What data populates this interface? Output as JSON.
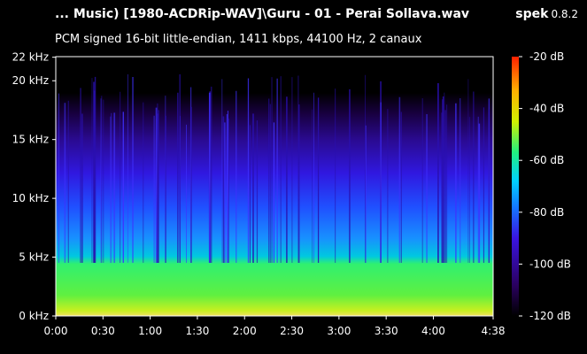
{
  "header": {
    "title": "... Music) [1980-ACDRip-WAV]\\Guru - 01 - Perai Sollava.wav",
    "app_name": "spek",
    "app_version": "0.8.2",
    "subtitle": "PCM signed 16-bit little-endian, 1411 kbps, 44100 Hz, 2 canaux"
  },
  "chart_data": {
    "type": "heatmap",
    "x_ticks": [
      "0:00",
      "0:30",
      "1:00",
      "1:30",
      "2:00",
      "2:30",
      "3:00",
      "3:30",
      "4:00",
      "4:38"
    ],
    "x_tick_seconds": [
      0,
      30,
      60,
      90,
      120,
      150,
      180,
      210,
      240,
      278
    ],
    "xlim_seconds": [
      0,
      278
    ],
    "y_ticks": [
      "0 kHz",
      "5 kHz",
      "10 kHz",
      "15 kHz",
      "20 kHz",
      "22 kHz"
    ],
    "y_tick_khz": [
      0,
      5,
      10,
      15,
      20,
      22
    ],
    "ylim_khz": [
      0,
      22.05
    ],
    "colorbar_ticks": [
      "-20 dB",
      "-40 dB",
      "-60 dB",
      "-80 dB",
      "-100 dB",
      "-120 dB"
    ],
    "colorbar_db": [
      -20,
      -40,
      -60,
      -80,
      -100,
      -120
    ],
    "colorbar_range_db": [
      -120,
      -20
    ],
    "colors": {
      "background": "#000000",
      "scale": [
        "#000000",
        "#2a0060",
        "#3a14e0",
        "#1478ff",
        "#00d0ff",
        "#20f080",
        "#d0f000",
        "#ffb000",
        "#ff2000"
      ]
    }
  }
}
